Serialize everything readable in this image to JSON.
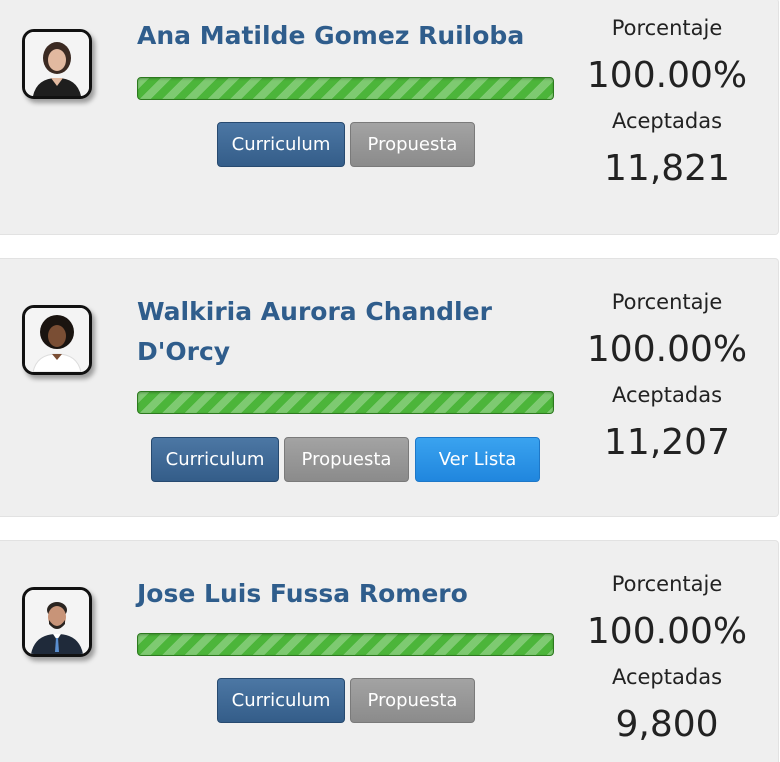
{
  "candidates": [
    {
      "name": "Ana Matilde Gomez Ruiloba",
      "avatar_icon": "candidate-photo-woman-icon",
      "progress_percent": 100,
      "buttons": {
        "curriculum": "Curriculum",
        "propuesta": "Propuesta"
      },
      "percent_label": "Porcentaje",
      "percent_value": "100.00%",
      "accepted_label": "Aceptadas",
      "accepted_value": "11,821"
    },
    {
      "name": "Walkiria Aurora Chandler D'Orcy",
      "avatar_icon": "candidate-photo-woman-icon",
      "progress_percent": 100,
      "buttons": {
        "curriculum": "Curriculum",
        "propuesta": "Propuesta",
        "ver_lista": "Ver Lista"
      },
      "percent_label": "Porcentaje",
      "percent_value": "100.00%",
      "accepted_label": "Aceptadas",
      "accepted_value": "11,207"
    },
    {
      "name": "Jose Luis Fussa Romero",
      "avatar_icon": "candidate-photo-man-icon",
      "progress_percent": 100,
      "buttons": {
        "curriculum": "Curriculum",
        "propuesta": "Propuesta"
      },
      "percent_label": "Porcentaje",
      "percent_value": "100.00%",
      "accepted_label": "Aceptadas",
      "accepted_value": "9,800"
    }
  ],
  "colors": {
    "name_text": "#2f5d8c",
    "progress_green": "#4cb53a",
    "curriculum_button": "#3f6a98",
    "propuesta_button": "#969696",
    "ver_lista_button": "#2b94e6"
  }
}
